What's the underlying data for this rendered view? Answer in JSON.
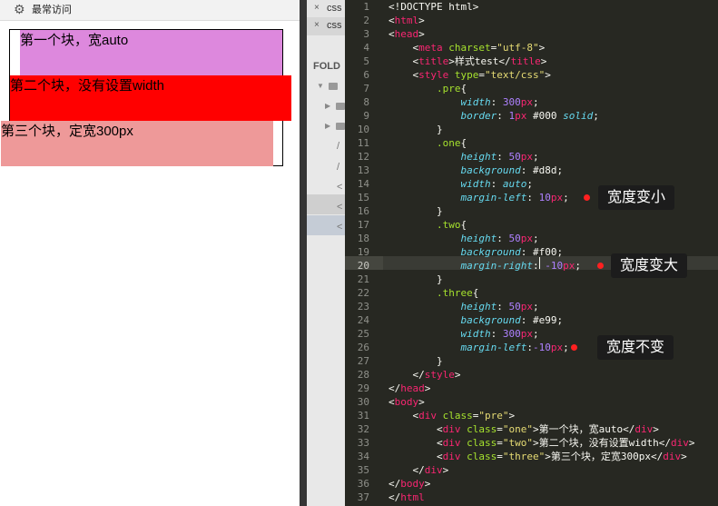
{
  "browser": {
    "bookmark_icon": "gear-icon",
    "bookmark_label": "最常访问",
    "blocks": [
      {
        "text": "第一个块，宽auto",
        "color": "#dd88dd"
      },
      {
        "text": "第二个块，没有设置width",
        "color": "#ff0000"
      },
      {
        "text": "第三个块，定宽300px",
        "color": "#ee9999"
      }
    ]
  },
  "sidebar": {
    "tabs": [
      {
        "close": "×",
        "label": "css"
      },
      {
        "close": "×",
        "label": "css"
      }
    ],
    "folders_label": "FOLD",
    "rows": [
      "/",
      "/",
      "<",
      "<",
      "<"
    ]
  },
  "editor": {
    "colors": {
      "background": "#272822",
      "tag": "#f92672",
      "attr": "#a6e22e",
      "string": "#e6db74",
      "property": "#66d9ef",
      "number": "#ae81ff",
      "text": "#f8f8f2"
    },
    "lines": [
      [
        [
          "t",
          "<!DOCTYPE html>"
        ]
      ],
      [
        [
          "t",
          "<"
        ],
        [
          "tag",
          "html"
        ],
        [
          "t",
          ">"
        ]
      ],
      [
        [
          "t",
          "<"
        ],
        [
          "tag",
          "head"
        ],
        [
          "t",
          ">"
        ]
      ],
      [
        [
          "t",
          "    <"
        ],
        [
          "tag",
          "meta"
        ],
        [
          "t",
          " "
        ],
        [
          "attr",
          "charset"
        ],
        [
          "t",
          "="
        ],
        [
          "str",
          "\"utf-8\""
        ],
        [
          "t",
          ">"
        ]
      ],
      [
        [
          "t",
          "    <"
        ],
        [
          "tag",
          "title"
        ],
        [
          "t",
          ">样式test</"
        ],
        [
          "tag",
          "title"
        ],
        [
          "t",
          ">"
        ]
      ],
      [
        [
          "t",
          "    <"
        ],
        [
          "tag",
          "style"
        ],
        [
          "t",
          " "
        ],
        [
          "attr",
          "type"
        ],
        [
          "t",
          "="
        ],
        [
          "str",
          "\"text/css\""
        ],
        [
          "t",
          ">"
        ]
      ],
      [
        [
          "t",
          "        "
        ],
        [
          "attr",
          ".pre"
        ],
        [
          "t",
          "{"
        ]
      ],
      [
        [
          "t",
          "            "
        ],
        [
          "prop",
          "width"
        ],
        [
          "t",
          ": "
        ],
        [
          "num",
          "300"
        ],
        [
          "tag",
          "px"
        ],
        [
          "t",
          ";"
        ]
      ],
      [
        [
          "t",
          "            "
        ],
        [
          "prop",
          "border"
        ],
        [
          "t",
          ": "
        ],
        [
          "num",
          "1"
        ],
        [
          "tag",
          "px"
        ],
        [
          "t",
          " #000 "
        ],
        [
          "prop",
          "solid"
        ],
        [
          "t",
          ";"
        ]
      ],
      [
        [
          "t",
          "        }"
        ]
      ],
      [
        [
          "t",
          "        "
        ],
        [
          "attr",
          ".one"
        ],
        [
          "t",
          "{"
        ]
      ],
      [
        [
          "t",
          "            "
        ],
        [
          "prop",
          "height"
        ],
        [
          "t",
          ": "
        ],
        [
          "num",
          "50"
        ],
        [
          "tag",
          "px"
        ],
        [
          "t",
          ";"
        ]
      ],
      [
        [
          "t",
          "            "
        ],
        [
          "prop",
          "background"
        ],
        [
          "t",
          ": #d8d;"
        ]
      ],
      [
        [
          "t",
          "            "
        ],
        [
          "prop",
          "width"
        ],
        [
          "t",
          ": "
        ],
        [
          "prop",
          "auto"
        ],
        [
          "t",
          ";"
        ]
      ],
      [
        [
          "t",
          "            "
        ],
        [
          "prop",
          "margin-left"
        ],
        [
          "t",
          ": "
        ],
        [
          "num",
          "10"
        ],
        [
          "tag",
          "px"
        ],
        [
          "t",
          ";"
        ]
      ],
      [
        [
          "t",
          "        }"
        ]
      ],
      [
        [
          "t",
          "        "
        ],
        [
          "attr",
          ".two"
        ],
        [
          "t",
          "{"
        ]
      ],
      [
        [
          "t",
          "            "
        ],
        [
          "prop",
          "height"
        ],
        [
          "t",
          ": "
        ],
        [
          "num",
          "50"
        ],
        [
          "tag",
          "px"
        ],
        [
          "t",
          ";"
        ]
      ],
      [
        [
          "t",
          "            "
        ],
        [
          "prop",
          "background"
        ],
        [
          "t",
          ": #f00;"
        ]
      ],
      [
        [
          "t",
          "            "
        ],
        [
          "prop",
          "margin-right"
        ],
        [
          "t",
          ": "
        ],
        [
          "num",
          "-10"
        ],
        [
          "tag",
          "px"
        ],
        [
          "t",
          ";"
        ]
      ],
      [
        [
          "t",
          "        }"
        ]
      ],
      [
        [
          "t",
          "        "
        ],
        [
          "attr",
          ".three"
        ],
        [
          "t",
          "{"
        ]
      ],
      [
        [
          "t",
          "            "
        ],
        [
          "prop",
          "height"
        ],
        [
          "t",
          ": "
        ],
        [
          "num",
          "50"
        ],
        [
          "tag",
          "px"
        ],
        [
          "t",
          ";"
        ]
      ],
      [
        [
          "t",
          "            "
        ],
        [
          "prop",
          "background"
        ],
        [
          "t",
          ": #e99;"
        ]
      ],
      [
        [
          "t",
          "            "
        ],
        [
          "prop",
          "width"
        ],
        [
          "t",
          ": "
        ],
        [
          "num",
          "300"
        ],
        [
          "tag",
          "px"
        ],
        [
          "t",
          ";"
        ]
      ],
      [
        [
          "t",
          "            "
        ],
        [
          "prop",
          "margin-left"
        ],
        [
          "t",
          ":"
        ],
        [
          "num",
          "-10"
        ],
        [
          "tag",
          "px"
        ],
        [
          "t",
          ";"
        ]
      ],
      [
        [
          "t",
          "        }"
        ]
      ],
      [
        [
          "t",
          "    </"
        ],
        [
          "tag",
          "style"
        ],
        [
          "t",
          ">"
        ]
      ],
      [
        [
          "t",
          "</"
        ],
        [
          "tag",
          "head"
        ],
        [
          "t",
          ">"
        ]
      ],
      [
        [
          "t",
          "<"
        ],
        [
          "tag",
          "body"
        ],
        [
          "t",
          ">"
        ]
      ],
      [
        [
          "t",
          "    <"
        ],
        [
          "tag",
          "div"
        ],
        [
          "t",
          " "
        ],
        [
          "attr",
          "class"
        ],
        [
          "t",
          "="
        ],
        [
          "str",
          "\"pre\""
        ],
        [
          "t",
          ">"
        ]
      ],
      [
        [
          "t",
          "        <"
        ],
        [
          "tag",
          "div"
        ],
        [
          "t",
          " "
        ],
        [
          "attr",
          "class"
        ],
        [
          "t",
          "="
        ],
        [
          "str",
          "\"one\""
        ],
        [
          "t",
          ">第一个块，宽auto</"
        ],
        [
          "tag",
          "div"
        ],
        [
          "t",
          ">"
        ]
      ],
      [
        [
          "t",
          "        <"
        ],
        [
          "tag",
          "div"
        ],
        [
          "t",
          " "
        ],
        [
          "attr",
          "class"
        ],
        [
          "t",
          "="
        ],
        [
          "str",
          "\"two\""
        ],
        [
          "t",
          ">第二个块，没有设置width</"
        ],
        [
          "tag",
          "div"
        ],
        [
          "t",
          ">"
        ]
      ],
      [
        [
          "t",
          "        <"
        ],
        [
          "tag",
          "div"
        ],
        [
          "t",
          " "
        ],
        [
          "attr",
          "class"
        ],
        [
          "t",
          "="
        ],
        [
          "str",
          "\"three\""
        ],
        [
          "t",
          ">第三个块，定宽300px</"
        ],
        [
          "tag",
          "div"
        ],
        [
          "t",
          ">"
        ]
      ],
      [
        [
          "t",
          "    </"
        ],
        [
          "tag",
          "div"
        ],
        [
          "t",
          ">"
        ]
      ],
      [
        [
          "t",
          "</"
        ],
        [
          "tag",
          "body"
        ],
        [
          "t",
          ">"
        ]
      ],
      [
        [
          "t",
          "</"
        ],
        [
          "tag",
          "html"
        ]
      ]
    ],
    "current_line": 20,
    "annotations": [
      {
        "line": 15,
        "text": "宽度变小"
      },
      {
        "line": 20,
        "text": "宽度变大"
      },
      {
        "line": 26,
        "text": "宽度不变"
      }
    ]
  }
}
